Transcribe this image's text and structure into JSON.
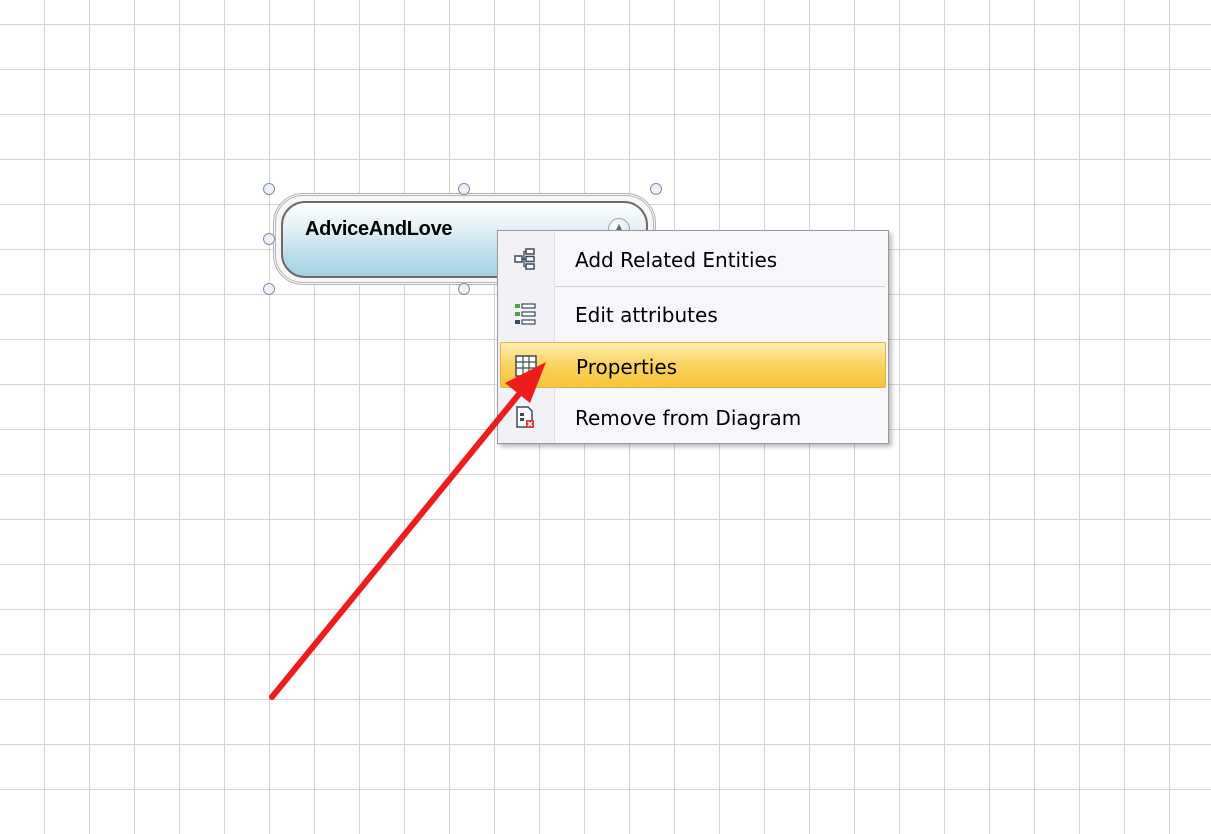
{
  "entity": {
    "name": "AdviceAndLove",
    "collapse_glyph": "▲"
  },
  "context_menu": {
    "items": [
      {
        "label": "Add Related Entities",
        "icon": "add-related-entities-icon"
      },
      {
        "label": "Edit attributes",
        "icon": "edit-attributes-icon"
      },
      {
        "label": "Properties",
        "icon": "properties-icon",
        "highlighted": true
      },
      {
        "label": "Remove from Diagram",
        "icon": "remove-from-diagram-icon"
      }
    ]
  },
  "colors": {
    "highlight": "#fbd35e",
    "annotation_arrow": "#ee1c1c",
    "entity_header": "#a6d3e3"
  }
}
